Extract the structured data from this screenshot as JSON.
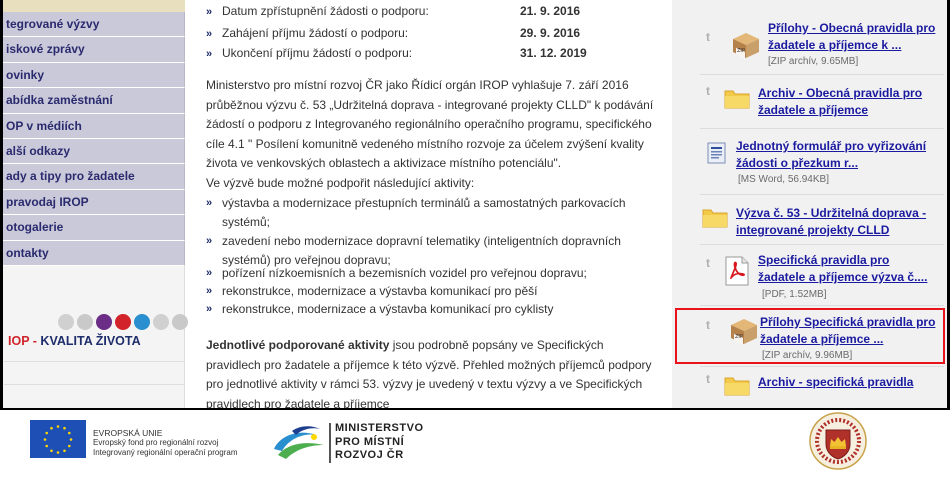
{
  "sidebar": {
    "items": [
      {
        "label": "tegrované výzvy"
      },
      {
        "label": "iskové zprávy"
      },
      {
        "label": "ovinky"
      },
      {
        "label": "abídka zaměstnání"
      },
      {
        "label": "OP v médiích"
      },
      {
        "label": "alší odkazy"
      },
      {
        "label": "ady a tipy pro žadatele"
      },
      {
        "label": "pravodaj IROP"
      },
      {
        "label": "otogalerie"
      },
      {
        "label": "ontakty"
      }
    ],
    "logo": {
      "iop": "IOP",
      "dash": " - ",
      "tagline": "KVALITA ŽIVOTA"
    },
    "dot_colors": [
      "#d0d0d0",
      "#c9c9c9",
      "#6b2d86",
      "#d2232a",
      "#2a8fcf",
      "#d0d0d0",
      "#c9c9c9"
    ]
  },
  "main": {
    "dates": [
      {
        "label": "Datum zpřístupnění žádosti o podporu:",
        "date": "21. 9. 2016"
      },
      {
        "label": "Zahájení příjmu žádostí o podporu:",
        "date": "29. 9. 2016"
      },
      {
        "label": "Ukončení příjmu žádostí o podporu:",
        "date": "31. 12. 2019"
      }
    ],
    "intro_lines": [
      "Ministerstvo pro místní rozvoj ČR jako Řídicí orgán IROP vyhlašuje 7. září 2016",
      "průběžnou výzvu č. 53 „Udržitelná doprava - integrované projekty CLLD\" k podávání",
      "žádostí o podporu z Integrovaného regionálního operačního programu, specifického",
      "cíle 4.1 \" Posílení komunitně vedeného místního rozvoje za účelem zvýšení kvality",
      "života ve venkovských oblastech a aktivizace místního potenciálu\".",
      "Ve výzvě bude možné podpořit následující aktivity:"
    ],
    "activities": [
      {
        "l1": "výstavba a modernizace přestupních terminálů a samostatných parkovacích",
        "l2": "systémů;"
      },
      {
        "l1": "zavedení nebo modernizace dopravní telematiky (inteligentních dopravních",
        "l2": "systémů) pro veřejnou dopravu;"
      },
      {
        "l1": "pořízení nízkoemisních a bezemisních vozidel pro veřejnou dopravu;",
        "l2": ""
      },
      {
        "l1": "rekonstrukce, modernizace a výstavba komunikací pro pěší",
        "l2": ""
      },
      {
        "l1": "rekonstrukce, modernizace a výstavba komunikací pro cyklisty",
        "l2": ""
      }
    ],
    "outro": {
      "bold": "Jednotlivé podporované aktivity",
      "line1_rest": " jsou podrobně popsány ve Specifických",
      "lines": [
        "pravidlech pro žadatele a příjemce k této výzvě. Přehled možných příjemců podpory",
        "pro jednotlivé aktivity v rámci 53. výzvy je uvedený v textu výzvy a ve Specifických",
        "pravidlech pro žadatele a příjemce"
      ]
    },
    "bullet_glyph": "»"
  },
  "right": {
    "t_glyph": "t",
    "files": [
      {
        "icon": "zip-box-icon",
        "line1": "Přílohy - Obecná pravidla pro",
        "line2": "žadatele a příjemce k ...",
        "meta": "[ZIP archív, 9.65MB]"
      },
      {
        "icon": "folder-icon",
        "line1": "Archiv - Obecná pravidla pro",
        "line2": "žadatele a příjemce",
        "meta": ""
      },
      {
        "icon": "word-doc-icon",
        "line1": "Jednotný formulář pro vyřizování",
        "line2": "žádosti o přezkum r...",
        "meta": "[MS Word, 56.94KB]"
      },
      {
        "icon": "folder-icon",
        "line1": "Výzva č. 53 - Udržitelná doprava -",
        "line2": "integrované projekty CLLD",
        "meta": ""
      },
      {
        "icon": "pdf-icon",
        "line1": "Specifická pravidla pro",
        "line2": "žadatele a příjemce  výzva č....",
        "meta": "[PDF, 1.52MB]"
      },
      {
        "icon": "zip-box-icon",
        "line1": "Přílohy  Specifická pravidla pro",
        "line2": "žadatele a příjemce  ...",
        "meta": "[ZIP archív, 9.96MB]"
      },
      {
        "icon": "folder-icon",
        "line1": "Archiv - specifická pravidla",
        "line2": "",
        "meta": ""
      }
    ],
    "highlight_color": "#e8131b"
  },
  "footer": {
    "eu": {
      "line1": "EVROPSKÁ UNIE",
      "line2": "Evropský fond pro regionální rozvoj",
      "line3": "Integrovaný regionální operační program"
    },
    "mmr": {
      "line1": "MINISTERSTVO",
      "line2": "PRO MÍSTNÍ",
      "line3": "ROZVOJ ČR"
    }
  }
}
